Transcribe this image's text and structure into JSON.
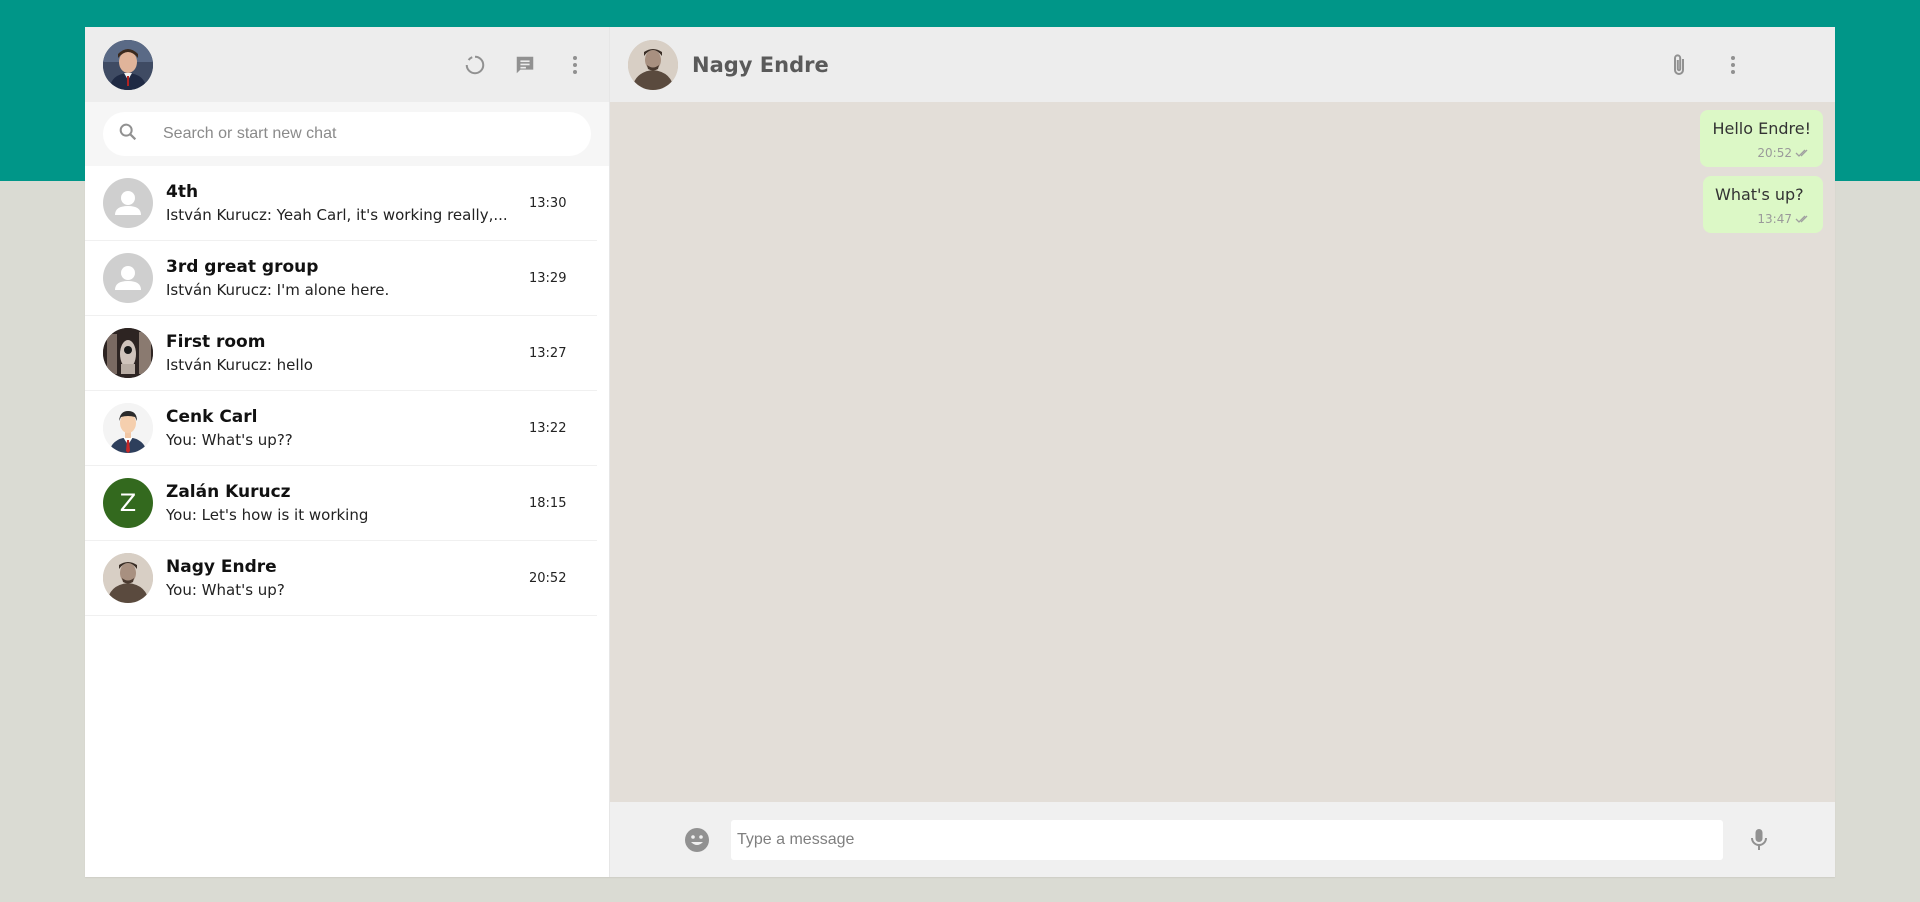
{
  "sidebar": {
    "search": {
      "placeholder": "Search or start new chat",
      "value": ""
    },
    "chats": [
      {
        "name": "4th",
        "last": "István Kurucz: Yeah Carl, it's working really,...",
        "time": "13:30",
        "avatar": "default-avatar-icon"
      },
      {
        "name": "3rd great group",
        "last": "István Kurucz: I'm alone here.",
        "time": "13:29",
        "avatar": "default-avatar-icon"
      },
      {
        "name": "First room",
        "last": "István Kurucz: hello",
        "time": "13:27",
        "avatar": "photo"
      },
      {
        "name": "Cenk Carl",
        "last": "You: What's up??",
        "time": "13:22",
        "avatar": "photo"
      },
      {
        "name": "Zalán Kurucz",
        "last": "You: Let's how is it working",
        "time": "18:15",
        "avatar": "Z",
        "avatar_color": "#33691e"
      },
      {
        "name": "Nagy Endre",
        "last": "You: What's up?",
        "time": "20:52",
        "avatar": "photo"
      }
    ]
  },
  "conversation": {
    "title": "Nagy Endre",
    "messages": [
      {
        "text": "Hello Endre!",
        "time": "20:52"
      },
      {
        "text": "What's up?",
        "time": "13:47"
      }
    ],
    "composer": {
      "placeholder": "Type a message",
      "value": ""
    }
  },
  "colors": {
    "brand": "#009688",
    "bubble": "#dcf8c6",
    "chat_bg": "#e3ded8",
    "header_bg": "#ededed"
  }
}
